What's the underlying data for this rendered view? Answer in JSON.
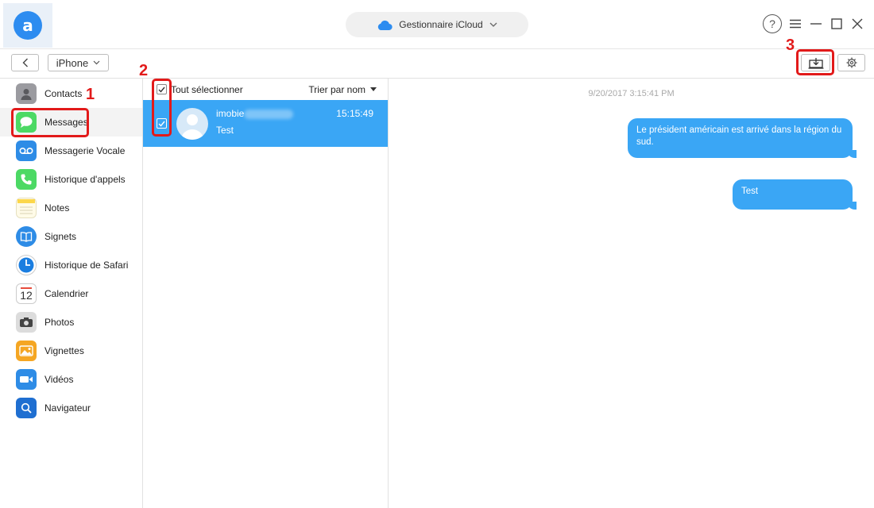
{
  "titlebar": {
    "logo_letter": "a",
    "manager_label": "Gestionnaire iCloud",
    "help_glyph": "?"
  },
  "toolbar": {
    "device_label": "iPhone"
  },
  "sidebar": {
    "items": [
      {
        "label": "Contacts",
        "icon": "contacts-icon",
        "color": "#8e8e93"
      },
      {
        "label": "Messages",
        "icon": "messages-icon",
        "color": "#4cd964"
      },
      {
        "label": "Messagerie Vocale",
        "icon": "voicemail-icon",
        "color": "#2e8ce6"
      },
      {
        "label": "Historique d'appels",
        "icon": "phone-icon",
        "color": "#4cd964"
      },
      {
        "label": "Notes",
        "icon": "notes-icon",
        "color": "#fcd74b"
      },
      {
        "label": "Signets",
        "icon": "bookmark-icon",
        "color": "#2e8ce6"
      },
      {
        "label": "Historique de Safari",
        "icon": "safari-icon",
        "color": "#1b7ee0"
      },
      {
        "label": "Calendrier",
        "icon": "calendar-icon",
        "color": "#ffffff"
      },
      {
        "label": "Photos",
        "icon": "camera-icon",
        "color": "#555555"
      },
      {
        "label": "Vignettes",
        "icon": "thumbnails-icon",
        "color": "#f5a623"
      },
      {
        "label": "Vidéos",
        "icon": "video-icon",
        "color": "#2e8ce6"
      },
      {
        "label": "Navigateur",
        "icon": "browser-search-icon",
        "color": "#1f6fd1"
      }
    ],
    "calendar_day": "12"
  },
  "list": {
    "select_all_label": "Tout sélectionner",
    "sort_label": "Trier par nom",
    "rows": [
      {
        "name": "imobie",
        "preview": "Test",
        "time": "15:15:49"
      }
    ]
  },
  "conversation": {
    "timestamp": "9/20/2017 3:15:41 PM",
    "messages": [
      {
        "text": "Le président américain est arrivé dans la région du sud."
      },
      {
        "text": "Test"
      }
    ]
  },
  "annotations": {
    "step1": "1",
    "step2": "2",
    "step3": "3",
    "color": "#e21a1a"
  },
  "colors": {
    "accent": "#3aa6f5",
    "selected_row": "#3aa6f5"
  }
}
